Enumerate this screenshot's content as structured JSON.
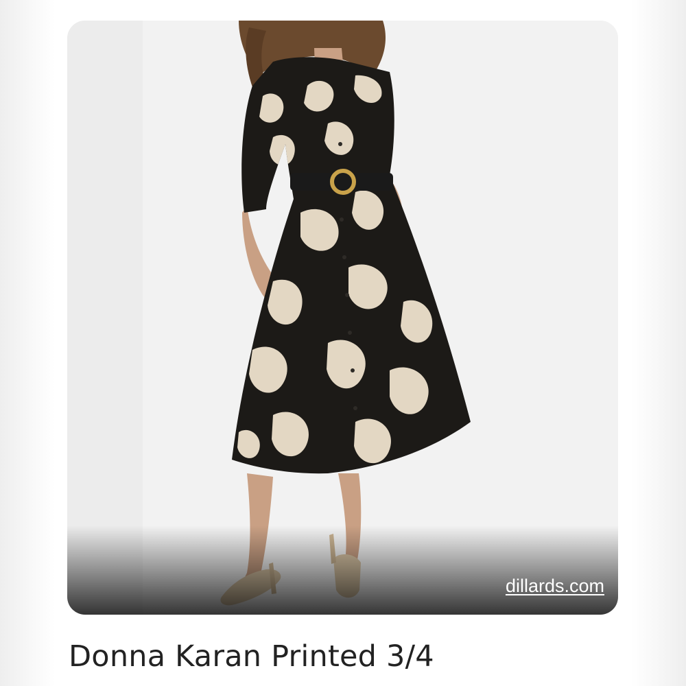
{
  "result": {
    "source_domain": "dillards.com",
    "title": "Donna Karan Printed 3/4"
  },
  "image": {
    "icon": "product-photo",
    "colors": {
      "background": "#f1f1f1",
      "dress_black": "#1c1a17",
      "dress_cream": "#e3d7c3",
      "skin": "#c9a084",
      "hair": "#6b4a2e",
      "belt_buckle": "#c9a24a",
      "sandals": "#d8c4a4"
    }
  }
}
